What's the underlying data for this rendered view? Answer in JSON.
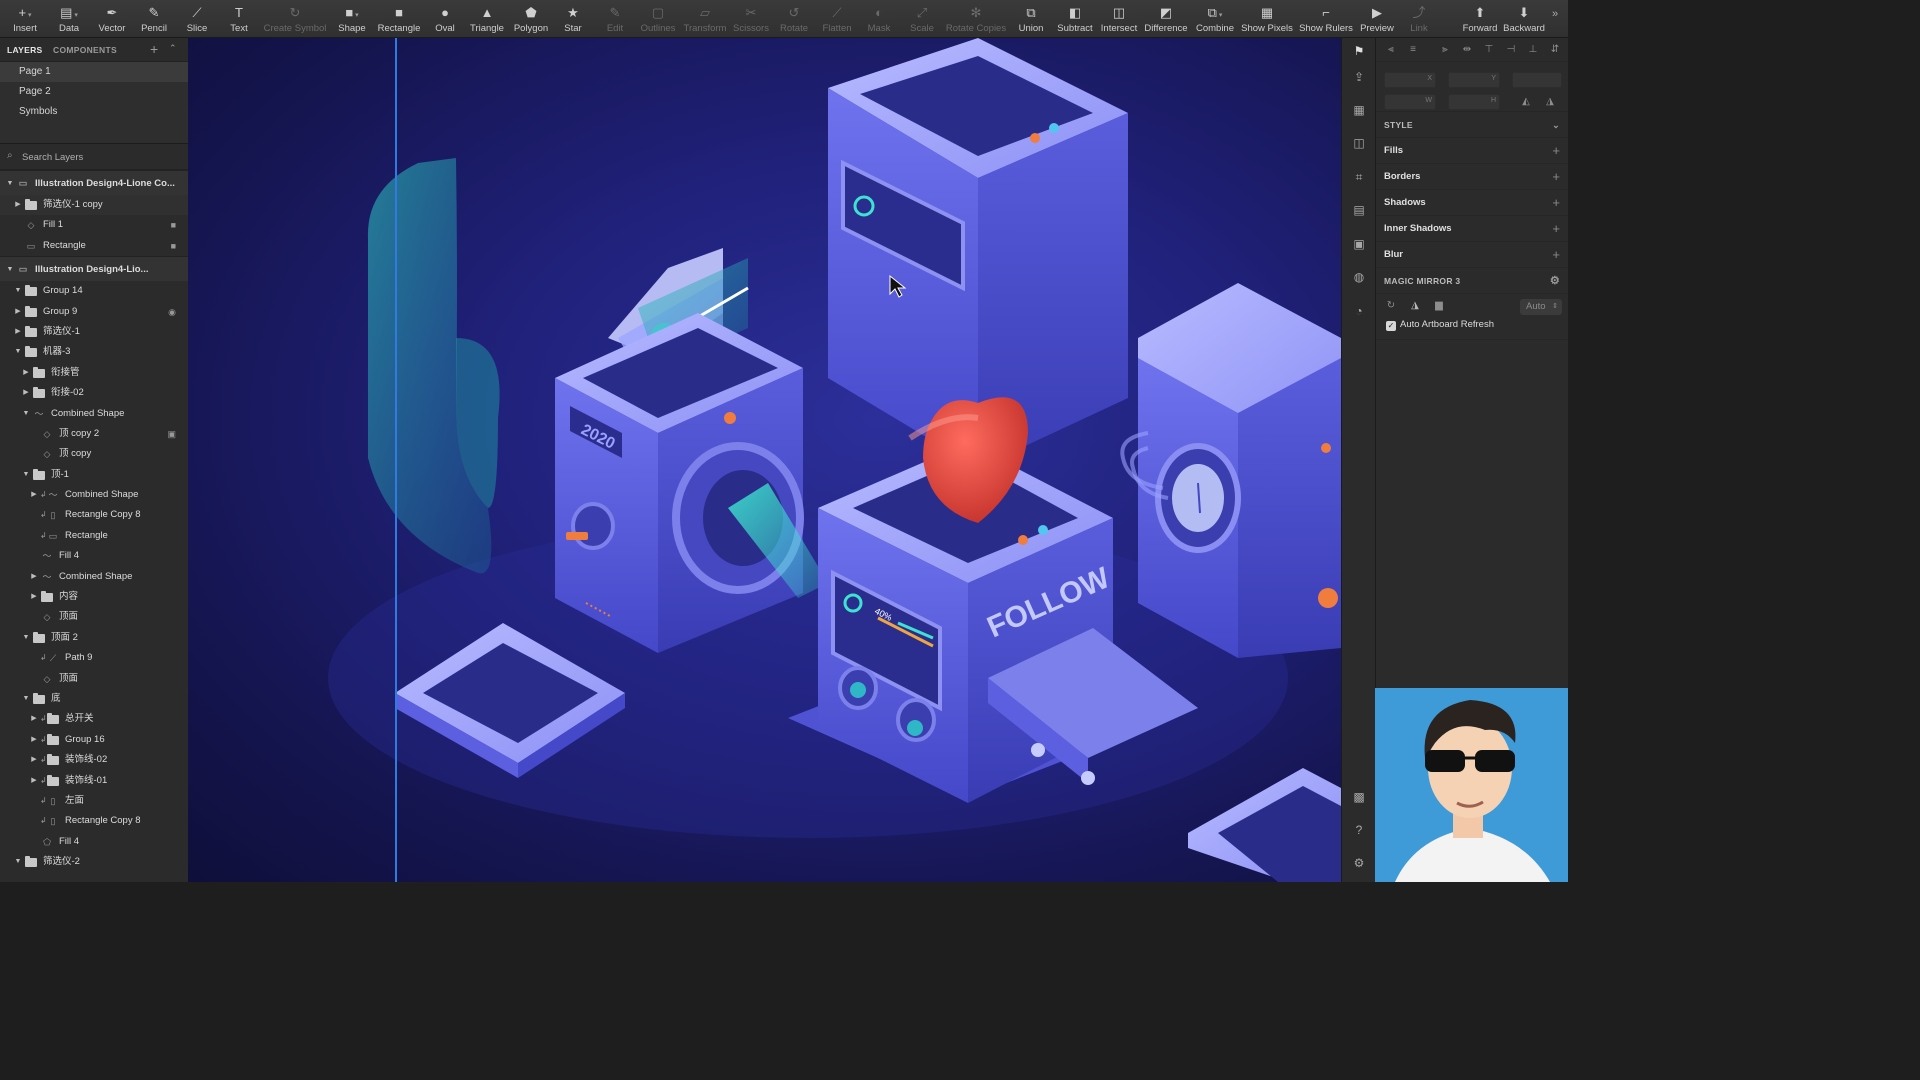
{
  "toolbar": {
    "tools": [
      {
        "label": "Insert",
        "icon": "plus-icon",
        "glyph": "+",
        "caret": true,
        "enabled": true
      },
      {
        "label": "Data",
        "icon": "data-icon",
        "glyph": "▤",
        "caret": true,
        "enabled": true
      },
      {
        "label": "Vector",
        "icon": "vector-pen-icon",
        "glyph": "✒",
        "enabled": true
      },
      {
        "label": "Pencil",
        "icon": "pencil-icon",
        "glyph": "✎",
        "enabled": true
      },
      {
        "label": "Slice",
        "icon": "slice-knife-icon",
        "glyph": "⟋",
        "enabled": true
      },
      {
        "label": "Text",
        "icon": "text-icon",
        "glyph": "T",
        "enabled": true
      },
      {
        "label": "Create Symbol",
        "icon": "create-symbol-icon",
        "glyph": "↻",
        "enabled": false
      },
      {
        "label": "Shape",
        "icon": "shape-icon",
        "glyph": "■",
        "caret": true,
        "enabled": true
      },
      {
        "label": "Rectangle",
        "icon": "rectangle-icon",
        "glyph": "■",
        "enabled": true
      },
      {
        "label": "Oval",
        "icon": "oval-icon",
        "glyph": "●",
        "enabled": true
      },
      {
        "label": "Triangle",
        "icon": "triangle-icon",
        "glyph": "▲",
        "enabled": true
      },
      {
        "label": "Polygon",
        "icon": "polygon-icon",
        "glyph": "⬟",
        "enabled": true
      },
      {
        "label": "Star",
        "icon": "star-icon",
        "glyph": "★",
        "enabled": true
      },
      {
        "label": "Edit",
        "icon": "edit-icon",
        "glyph": "✎",
        "enabled": false
      },
      {
        "label": "Outlines",
        "icon": "outlines-icon",
        "glyph": "▢",
        "enabled": false
      },
      {
        "label": "Transform",
        "icon": "transform-icon",
        "glyph": "▱",
        "enabled": false
      },
      {
        "label": "Scissors",
        "icon": "scissors-icon",
        "glyph": "✂",
        "enabled": false
      },
      {
        "label": "Rotate",
        "icon": "rotate-icon",
        "glyph": "↺",
        "enabled": false
      },
      {
        "label": "Flatten",
        "icon": "flatten-icon",
        "glyph": "⟋",
        "enabled": false
      },
      {
        "label": "Mask",
        "icon": "mask-icon",
        "glyph": "◐",
        "enabled": false
      },
      {
        "label": "Scale",
        "icon": "scale-icon",
        "glyph": "⤢",
        "enabled": false
      },
      {
        "label": "Rotate Copies",
        "icon": "rotate-copies-icon",
        "glyph": "✻",
        "enabled": false
      },
      {
        "label": "Union",
        "icon": "union-icon",
        "glyph": "⧉",
        "enabled": true
      },
      {
        "label": "Subtract",
        "icon": "subtract-icon",
        "glyph": "◧",
        "enabled": true
      },
      {
        "label": "Intersect",
        "icon": "intersect-icon",
        "glyph": "◫",
        "enabled": true
      },
      {
        "label": "Difference",
        "icon": "difference-icon",
        "glyph": "◩",
        "enabled": true
      },
      {
        "label": "Combine",
        "icon": "combine-icon",
        "glyph": "⧉",
        "caret": true,
        "enabled": true
      },
      {
        "label": "Show Pixels",
        "icon": "show-pixels-icon",
        "glyph": "▦",
        "enabled": true
      },
      {
        "label": "Show Rulers",
        "icon": "show-rulers-icon",
        "glyph": "⌐",
        "enabled": true
      },
      {
        "label": "Preview",
        "icon": "preview-play-icon",
        "glyph": "▶",
        "enabled": true
      },
      {
        "label": "Link",
        "icon": "link-icon",
        "glyph": "⤴",
        "enabled": false
      },
      {
        "label": "Forward",
        "icon": "forward-icon",
        "glyph": "⬆",
        "enabled": true
      },
      {
        "label": "Backward",
        "icon": "backward-icon",
        "glyph": "⬇",
        "enabled": true
      }
    ]
  },
  "left_panel": {
    "tabs": {
      "layers": "LAYERS",
      "components": "COMPONENTS"
    },
    "pages": [
      {
        "name": "Page 1",
        "selected": true
      },
      {
        "name": "Page 2",
        "selected": false
      },
      {
        "name": "Symbols",
        "selected": false
      }
    ],
    "search_placeholder": "Search Layers",
    "layers": [
      {
        "name": "Illustration Design4-Lione Co...",
        "depth": 0,
        "kind": "artboard",
        "open": true
      },
      {
        "name": "筛选仪-1 copy",
        "depth": 1,
        "kind": "folder",
        "open": false,
        "highlight": true
      },
      {
        "name": "Fill 1",
        "depth": 1,
        "kind": "shape",
        "lock": true
      },
      {
        "name": "Rectangle",
        "depth": 1,
        "kind": "rect",
        "lock": true
      },
      {
        "name": "Illustration Design4-Lio...",
        "depth": 0,
        "kind": "artboard",
        "open": true
      },
      {
        "name": "Group 14",
        "depth": 1,
        "kind": "folder",
        "open": true
      },
      {
        "name": "Group 9",
        "depth": 1,
        "kind": "folder",
        "open": false,
        "hidden": true
      },
      {
        "name": "筛选仪-1",
        "depth": 1,
        "kind": "folder",
        "open": false
      },
      {
        "name": "机器-3",
        "depth": 1,
        "kind": "folder",
        "open": true
      },
      {
        "name": "衔接管",
        "depth": 2,
        "kind": "folder",
        "open": false
      },
      {
        "name": "衔接-02",
        "depth": 2,
        "kind": "folder",
        "open": false
      },
      {
        "name": "Combined Shape",
        "depth": 2,
        "kind": "combined",
        "open": true
      },
      {
        "name": "顶 copy 2",
        "depth": 3,
        "kind": "shape",
        "symbol": true
      },
      {
        "name": "顶 copy",
        "depth": 3,
        "kind": "shape"
      },
      {
        "name": "顶-1",
        "depth": 2,
        "kind": "folder",
        "open": true
      },
      {
        "name": "Combined Shape",
        "depth": 3,
        "kind": "combined",
        "open": false,
        "masked": true
      },
      {
        "name": "Rectangle Copy 8",
        "depth": 3,
        "kind": "line",
        "masked": true
      },
      {
        "name": "Rectangle",
        "depth": 3,
        "kind": "rect",
        "masked": true
      },
      {
        "name": "Fill 4",
        "depth": 3,
        "kind": "combined"
      },
      {
        "name": "Combined Shape",
        "depth": 3,
        "kind": "combined",
        "open": false
      },
      {
        "name": "内容",
        "depth": 3,
        "kind": "folder",
        "open": false
      },
      {
        "name": "顶面",
        "depth": 3,
        "kind": "shape"
      },
      {
        "name": "顶面 2",
        "depth": 2,
        "kind": "folder",
        "open": true
      },
      {
        "name": "Path 9",
        "depth": 3,
        "kind": "path",
        "masked": true
      },
      {
        "name": "顶面",
        "depth": 3,
        "kind": "shape"
      },
      {
        "name": "底",
        "depth": 2,
        "kind": "folder",
        "open": true
      },
      {
        "name": "总开关",
        "depth": 3,
        "kind": "folder",
        "open": false,
        "masked": true
      },
      {
        "name": "Group 16",
        "depth": 3,
        "kind": "folder",
        "open": false,
        "masked": true
      },
      {
        "name": "装饰线-02",
        "depth": 3,
        "kind": "folder",
        "open": false,
        "masked": true
      },
      {
        "name": "装饰线-01",
        "depth": 3,
        "kind": "folder",
        "open": false,
        "masked": true
      },
      {
        "name": "左面",
        "depth": 3,
        "kind": "line",
        "masked": true
      },
      {
        "name": "Rectangle Copy 8",
        "depth": 3,
        "kind": "line",
        "masked": true
      },
      {
        "name": "Fill 4",
        "depth": 3,
        "kind": "fillshape"
      },
      {
        "name": "筛选仪-2",
        "depth": 1,
        "kind": "folder",
        "open": true
      }
    ]
  },
  "canvas": {
    "machine_text_2020": "2020",
    "machine_text_follow": "FOLLOW",
    "machine_text_percent": "40%",
    "colors": {
      "bg": "#1b1c66",
      "machine": "#5b5fe0",
      "machine_light": "#8c90f5",
      "heart": "#e2453c",
      "accent": "#3de2d0",
      "guide": "#2f7be0"
    }
  },
  "inspector": {
    "fields": {
      "x": "X",
      "y": "Y",
      "w": "W",
      "h": "H"
    },
    "style_header": "STYLE",
    "sections": [
      "Fills",
      "Borders",
      "Shadows",
      "Inner Shadows",
      "Blur"
    ],
    "plugin_header": "MAGIC MIRROR 3",
    "auto_label": "Auto",
    "auto_refresh_label": "Auto Artboard Refresh",
    "auto_refresh_checked": true
  }
}
